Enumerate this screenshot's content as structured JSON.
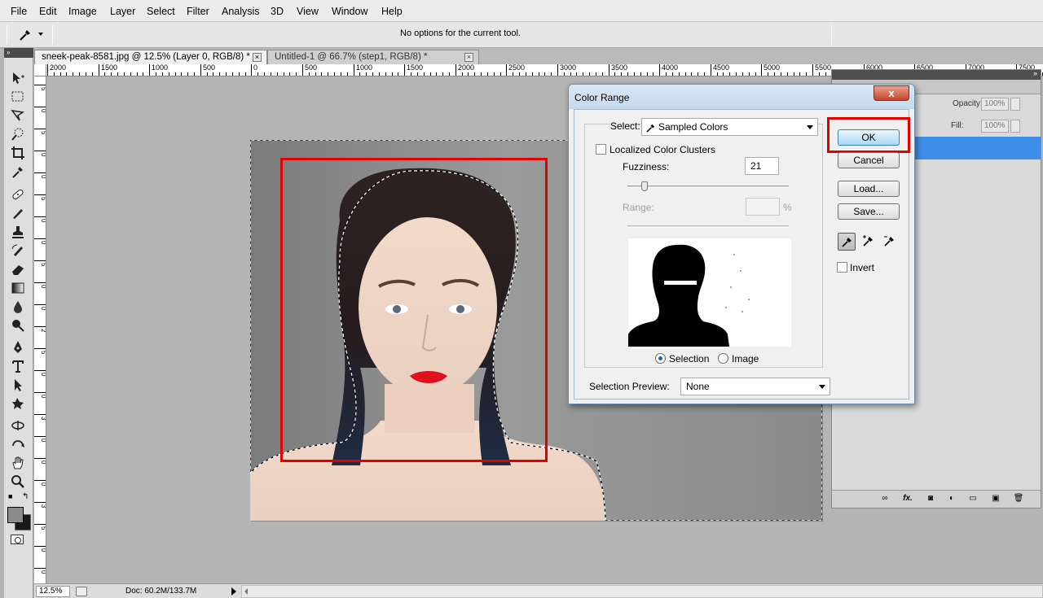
{
  "menubar": {
    "items": [
      "File",
      "Edit",
      "Image",
      "Layer",
      "Select",
      "Filter",
      "Analysis",
      "3D",
      "View",
      "Window",
      "Help"
    ]
  },
  "options": {
    "message": "No options for the current tool."
  },
  "doc_tabs": [
    {
      "label": "sneek-peak-8581.jpg @ 12.5% (Layer 0, RGB/8) *",
      "close": "×"
    },
    {
      "label": "Untitled-1 @ 66.7% (step1, RGB/8) *",
      "close": "×"
    }
  ],
  "ruler_top": [
    "2000",
    "1500",
    "1000",
    "500",
    "0",
    "500",
    "1000",
    "1500",
    "2000",
    "2500",
    "3000",
    "3500",
    "4000",
    "4500",
    "5000",
    "5500",
    "6000",
    "6500",
    "7000",
    "7500"
  ],
  "ruler_left": [
    "5",
    "0",
    "5",
    "0",
    "0",
    "5",
    "0",
    "0",
    "5",
    "0",
    "0",
    "2",
    "5",
    "0",
    "0",
    "3",
    "0",
    "0",
    "0",
    "3",
    "5",
    "0",
    "0"
  ],
  "statusbar": {
    "zoom": "12.5%",
    "doc_info": "Doc: 60.2M/133.7M"
  },
  "layers_panel": {
    "collapse": "»",
    "opacity_label": "Opacity:",
    "opacity_value": "100%",
    "fill_label": "Fill:",
    "fill_value": "100%",
    "footer_icons": [
      "link-icon",
      "fx-icon",
      "mask-icon",
      "adjustment-icon",
      "group-icon",
      "new-layer-icon",
      "trash-icon"
    ]
  },
  "toolbox": {
    "header": "»",
    "tools": [
      "move-tool-icon",
      "marquee-tool-icon",
      "lasso-tool-icon",
      "quick-selection-tool-icon",
      "crop-tool-icon",
      "eyedropper-tool-icon",
      "healing-brush-tool-icon",
      "brush-tool-icon",
      "clone-stamp-tool-icon",
      "history-brush-tool-icon",
      "eraser-tool-icon",
      "gradient-tool-icon",
      "blur-tool-icon",
      "dodge-tool-icon",
      "pen-tool-icon",
      "type-tool-icon",
      "path-selection-tool-icon",
      "shape-tool-icon",
      "3d-rotate-tool-icon",
      "3d-orbit-tool-icon",
      "hand-tool-icon",
      "zoom-tool-icon"
    ]
  },
  "dialog": {
    "title": "Color Range",
    "close": "x",
    "select_label": "Select:",
    "select_value": "Sampled Colors",
    "localized_label": "Localized Color Clusters",
    "fuzziness_label": "Fuzziness:",
    "fuzziness_value": "21",
    "range_label": "Range:",
    "range_pct": "%",
    "radio_selection": "Selection",
    "radio_image": "Image",
    "preview_label": "Selection Preview:",
    "preview_value": "None",
    "ok": "OK",
    "cancel": "Cancel",
    "load": "Load...",
    "save": "Save...",
    "invert": "Invert"
  },
  "colors": {
    "highlight_red": "#e00000",
    "selected_layer_blue": "#3d8ee8"
  }
}
